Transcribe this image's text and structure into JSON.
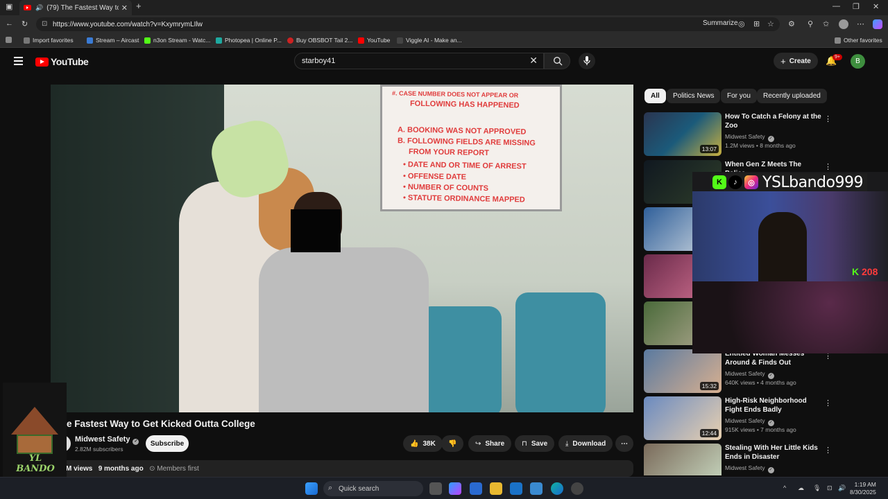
{
  "browser": {
    "tab_title": "(79) The Fastest Way to Get K",
    "url": "https://www.youtube.com/watch?v=KxymrymLIlw",
    "summarize_label": "Summarize",
    "bookmarks": [
      {
        "label": "Import favorites",
        "color": "#888888"
      },
      {
        "label": "Stream – Aircast",
        "color": "#3a7bd5"
      },
      {
        "label": "n3on Stream - Watc...",
        "color": "#53fc18"
      },
      {
        "label": "Photopea | Online P...",
        "color": "#1ea9a0"
      },
      {
        "label": "Buy OBSBOT Tail 2...",
        "color": "#cc2222"
      },
      {
        "label": "YouTube",
        "color": "#ff0000"
      },
      {
        "label": "Viggle AI - Make an...",
        "color": "#444444"
      }
    ],
    "other_favorites": "Other favorites"
  },
  "youtube": {
    "logo_text": "YouTube",
    "search_value": "starboy41",
    "create_label": "Create",
    "notif_badge": "9+",
    "avatar_letter": "B",
    "accent": "#ff0000"
  },
  "video": {
    "title": "e Fastest Way to Get Kicked Outta College",
    "channel": "Midwest Safety",
    "subscribers": "2.82M subscribers",
    "subscribe_label": "Subscribe",
    "likes": "38K",
    "share_label": "Share",
    "save_label": "Save",
    "download_label": "Download",
    "views": "M views",
    "age": "9 months ago",
    "members": "Members first",
    "poster_lines": [
      "#. CASE NUMBER DOES NOT APPEAR OR",
      "FOLLOWING HAS HAPPENED",
      "A. BOOKING WAS NOT APPROVED",
      "B. FOLLOWING FIELDS ARE MISSING",
      "FROM YOUR REPORT",
      "• DATE AND OR TIME OF ARREST",
      "• OFFENSE DATE",
      "• NUMBER OF COUNTS",
      "• STATUTE   ORDINANCE MAPPED"
    ]
  },
  "chips": [
    "All",
    "Politics News",
    "For you",
    "Recently uploaded"
  ],
  "recommendations": [
    {
      "title": "How To Catch a Felony at the Zoo",
      "channel": "Midwest Safety",
      "meta": "1.2M views • 8 months ago",
      "duration": "13:07",
      "color": "#2a3550"
    },
    {
      "title": "When Gen Z Meets The Police",
      "channel": "",
      "meta": "",
      "duration": "",
      "color": "#1d2a22"
    },
    {
      "title": "",
      "channel": "",
      "meta": "",
      "duration": "",
      "color": "#3b6aa0"
    },
    {
      "title": "",
      "channel": "",
      "meta": "",
      "duration": "",
      "color": "#8a3a5a"
    },
    {
      "title": "",
      "channel": "",
      "meta": "",
      "duration": "",
      "color": "#4a6a3a"
    },
    {
      "title": "Entitled Woman Messes Around & Finds Out",
      "channel": "Midwest Safety",
      "meta": "640K views • 4 months ago",
      "duration": "15:32",
      "color": "#5a7aa0"
    },
    {
      "title": "High-Risk Neighborhood Fight Ends Badly",
      "channel": "Midwest Safety",
      "meta": "915K views • 7 months ago",
      "duration": "12:44",
      "color": "#6a8ac0"
    },
    {
      "title": "Stealing With Her Little Kids Ends in Disaster",
      "channel": "Midwest Safety",
      "meta": "",
      "duration": "",
      "color": "#7a6a5a"
    }
  ],
  "overlay": {
    "handle": "YSLbando999",
    "kick_count": "208"
  },
  "streamer_logo": {
    "text": "YL BANDO"
  },
  "taskbar": {
    "search_placeholder": "Quick search",
    "time": "1:19 AM",
    "date": "8/30/2025"
  }
}
